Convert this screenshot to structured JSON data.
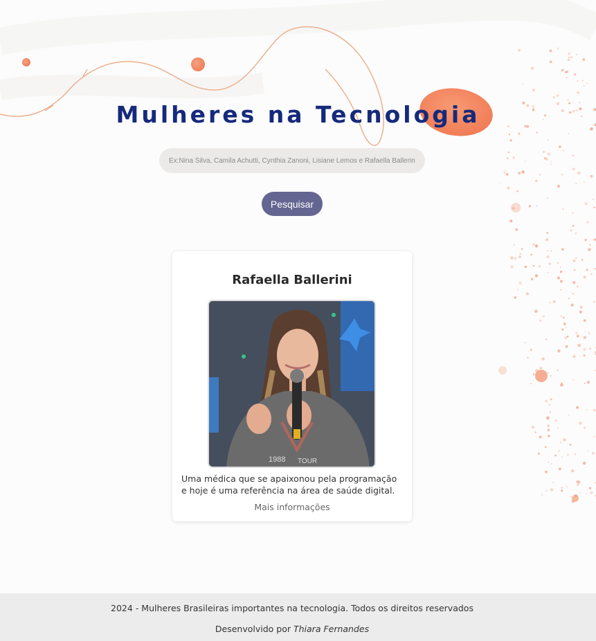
{
  "page": {
    "title": "Mulheres na Tecnologia"
  },
  "search": {
    "placeholder": "Ex:Nina Silva, Camila Achutti, Cynthia Zanoni, Lisiane Lemos e Rafaella Ballerine",
    "value": "",
    "button_label": "Pesquisar"
  },
  "card": {
    "name": "Rafaella Ballerini",
    "description": "Uma médica que se apaixonou pela programação e hoje é uma referência na área de saúde digital.",
    "link_label": "Mais informações",
    "photo_icon": "person-photo"
  },
  "footer": {
    "copyright": "2024 - Mulheres Brasileiras importantes na tecnologia. Todos os direitos reservados",
    "credit_prefix": "Desenvolvido por",
    "credit_name": "Thiara Fernandes"
  },
  "colors": {
    "title": "#152a7c",
    "button": "#646590",
    "accent": "#f28a65",
    "footer_bg": "#ececed"
  }
}
